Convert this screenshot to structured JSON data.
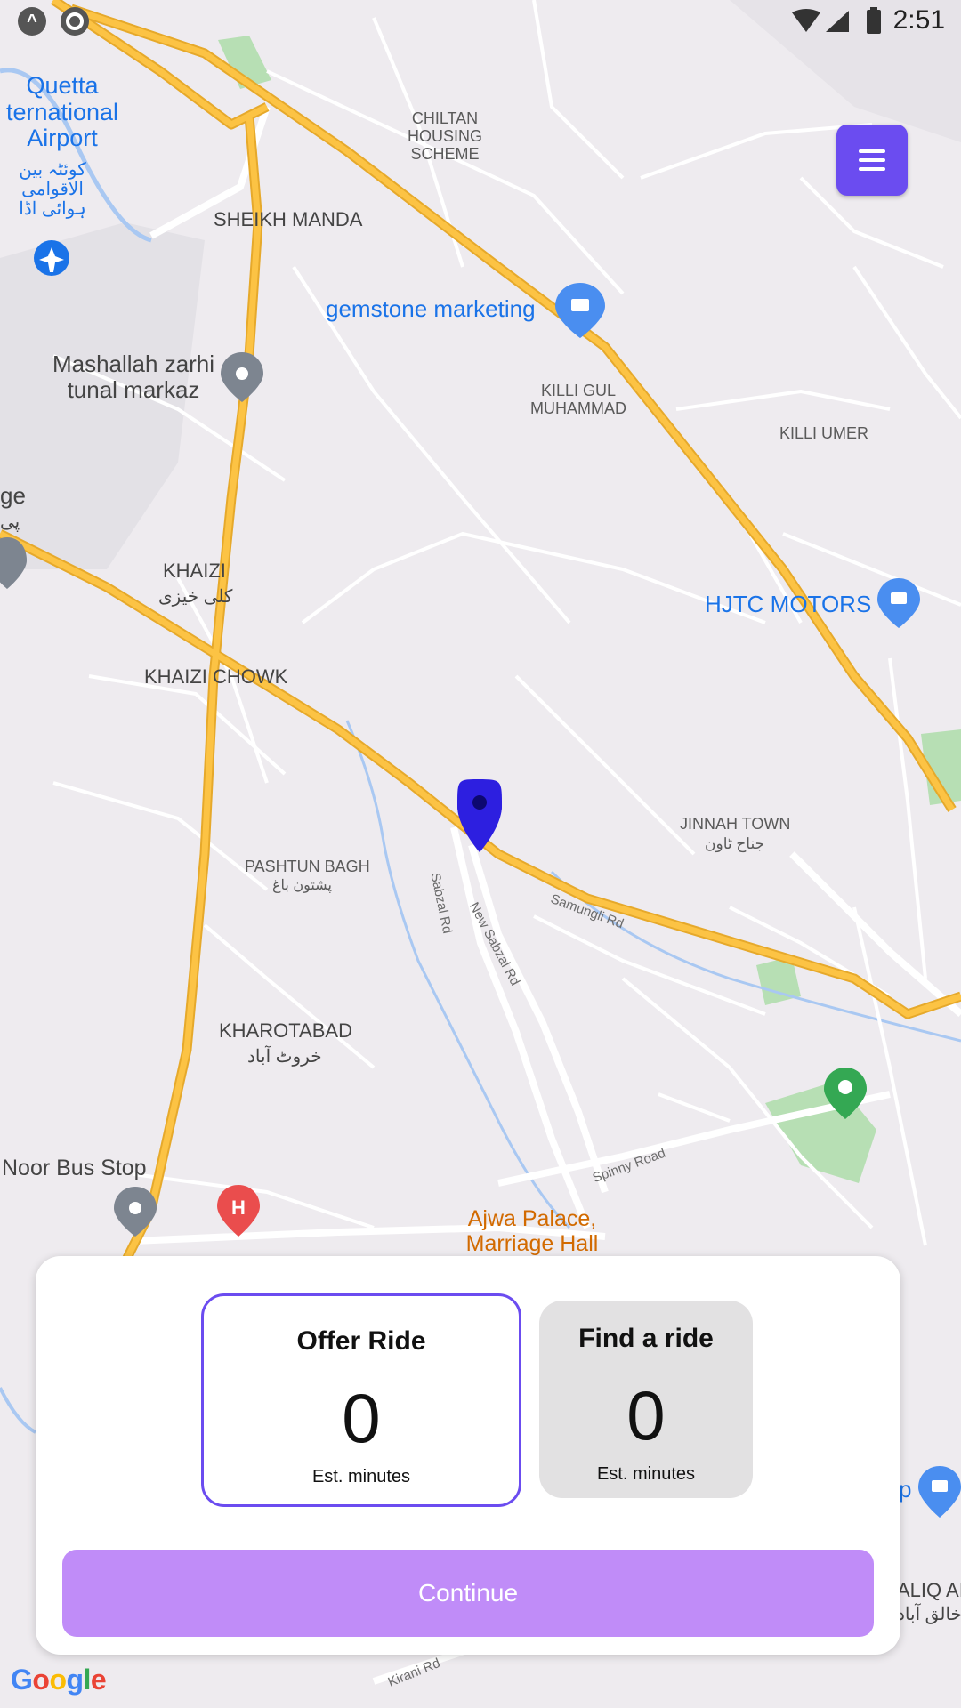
{
  "status_bar": {
    "time": "2:51",
    "left_icons": [
      "app-a-icon",
      "circle-icon"
    ]
  },
  "menu": {
    "icon": "hamburger-menu-icon"
  },
  "map": {
    "places": {
      "quetta_airport": "Quetta\nternational\nAirport",
      "quetta_airport_urdu": "کوئٹہ بین\nالاقوامی\nہوائی اڈا",
      "chiltan": "CHILTAN\nHOUSING\nSCHEME",
      "sheikh_manda": "SHEIKH MANDA",
      "gemstone": "gemstone marketing",
      "mashallah": "Mashallah zarhi\ntunal markaz",
      "killi_gul": "KILLI GUL\nMUHAMMAD",
      "killi_umer": "KILLI UMER",
      "ge_partial": "ge",
      "ge_urdu": "پی",
      "khaizi": "KHAIZI",
      "khaizi_urdu": "کلی خیزی",
      "hjtc": "HJTC MOTORS",
      "khaizi_chowk": "KHAIZI CHOWK",
      "jinnah_town": "JINNAH TOWN",
      "jinnah_town_urdu": "جناح ٹاون",
      "pashtun_bagh": "PASHTUN BAGH",
      "pashtun_bagh_urdu": "پشتون باغ",
      "kharotabad": "KHAROTABAD",
      "kharotabad_urdu": "خروٹ آباد",
      "noor_bus_stop": "Noor Bus Stop",
      "ajwa": "Ajwa Palace,\nMarriage Hall",
      "p_partial": "p",
      "aliq_partial": "ALIQ AI",
      "aliq_urdu": "خالق آباد"
    },
    "roads": {
      "samungli": "Samungli Rd",
      "sabzal": "Sabzal Rd",
      "new_sabzal": "New Sabzal Rd",
      "spinny": "Spinny Road",
      "kirani": "Kirani Rd"
    },
    "colors": {
      "background": "#eeebef",
      "major_road": "#fcc344",
      "minor_road": "#ffffff",
      "water": "#a9c8f2",
      "park": "#b7dfb4",
      "pin": "#2d1fe0"
    }
  },
  "ride_panel": {
    "offer": {
      "title": "Offer Ride",
      "value": "0",
      "sub": "Est. minutes",
      "selected": true
    },
    "find": {
      "title": "Find a ride",
      "value": "0",
      "sub": "Est. minutes",
      "selected": false
    },
    "continue_label": "Continue"
  },
  "attribution": {
    "google": "Google"
  }
}
